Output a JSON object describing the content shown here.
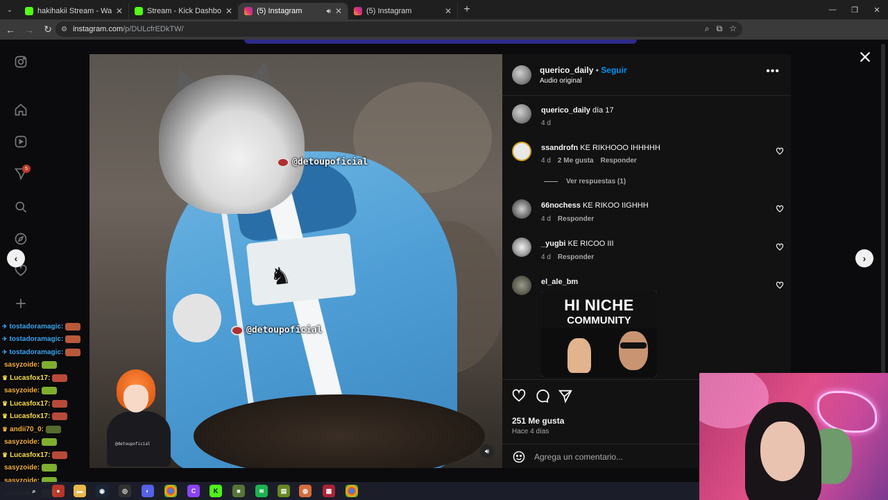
{
  "browser": {
    "tabs": [
      {
        "title": "hakihakii Stream - Watch Live o",
        "favicon_color": "#53fc18",
        "active": false
      },
      {
        "title": "Stream - Kick Dashboard",
        "favicon_color": "#53fc18",
        "active": false
      },
      {
        "title": "(5) Instagram",
        "favicon_color": "#e1306c",
        "active": true,
        "audio": true
      },
      {
        "title": "(5) Instagram",
        "favicon_color": "#e1306c",
        "active": false
      }
    ],
    "url_host": "instagram.com",
    "url_path": "/p/DULcfrEDkTW/"
  },
  "post": {
    "author": "querico_daily",
    "dot": "•",
    "follow_label": "Seguir",
    "audio_label": "Audio original",
    "more_label": "•••",
    "media_watermarks": [
      "@detoupoficial",
      "@detoupoficial"
    ],
    "caption": {
      "user": "querico_daily",
      "text": "día 17",
      "time": "4 d"
    },
    "comments": [
      {
        "user": "ssandrofn",
        "text": "KE RIKHOOO IHHHHH",
        "time": "4 d",
        "likes": "2 Me gusta",
        "reply": "Responder",
        "view_replies": "Ver respuestas (1)"
      },
      {
        "user": "66nochess",
        "text": "KE RIKOO IIGHHH",
        "time": "4 d",
        "reply": "Responder"
      },
      {
        "user": "_yugbi",
        "text": "KE RICOO III",
        "time": "4 d",
        "reply": "Responder"
      },
      {
        "user": "el_ale_bm",
        "text": "",
        "meme_line1": "HI NICHE",
        "meme_line2": "COMMUNITY"
      }
    ],
    "likes": "251 Me gusta",
    "posted": "Hace 4 días",
    "comment_placeholder": "Agrega un comentario..."
  },
  "sidebar": {
    "icons": [
      "instagram-icon",
      "home-icon",
      "reels-icon",
      "messages-icon",
      "search-icon",
      "explore-icon",
      "notifications-icon",
      "create-icon"
    ],
    "notification_count": "5"
  },
  "chat": [
    {
      "user": "tostadoramagic:",
      "color": "#3fa9f5",
      "badge": "✈"
    },
    {
      "user": "tostadoramagic:",
      "color": "#3fa9f5",
      "badge": "✈"
    },
    {
      "user": "tostadoramagic:",
      "color": "#3fa9f5",
      "badge": "✈"
    },
    {
      "user": "sasyzoide:",
      "color": "#f5b13f",
      "badge": ""
    },
    {
      "user": "Lucasfox17:",
      "color": "#ffe14d",
      "badge": "♛"
    },
    {
      "user": "sasyzoide:",
      "color": "#f5b13f",
      "badge": ""
    },
    {
      "user": "Lucasfox17:",
      "color": "#ffe14d",
      "badge": "♛"
    },
    {
      "user": "Lucasfox17:",
      "color": "#ffe14d",
      "badge": "♛"
    },
    {
      "user": "andii70_0:",
      "color": "#f5b13f",
      "badge": "♛"
    },
    {
      "user": "sasyzoide:",
      "color": "#f5b13f",
      "badge": ""
    },
    {
      "user": "Lucasfox17:",
      "color": "#ffe14d",
      "badge": "♛"
    },
    {
      "user": "sasyzoide:",
      "color": "#f5b13f",
      "badge": ""
    },
    {
      "user": "sasyzoide:",
      "color": "#f5b13f",
      "badge": ""
    },
    {
      "user": "sasyzoide:",
      "color": "#f5b13f",
      "badge": ""
    }
  ],
  "vtuber_tag": "@detoupoficial",
  "colors": {
    "accent": "#0095f6",
    "panel": "#121212",
    "muted": "#a8a8a8"
  }
}
